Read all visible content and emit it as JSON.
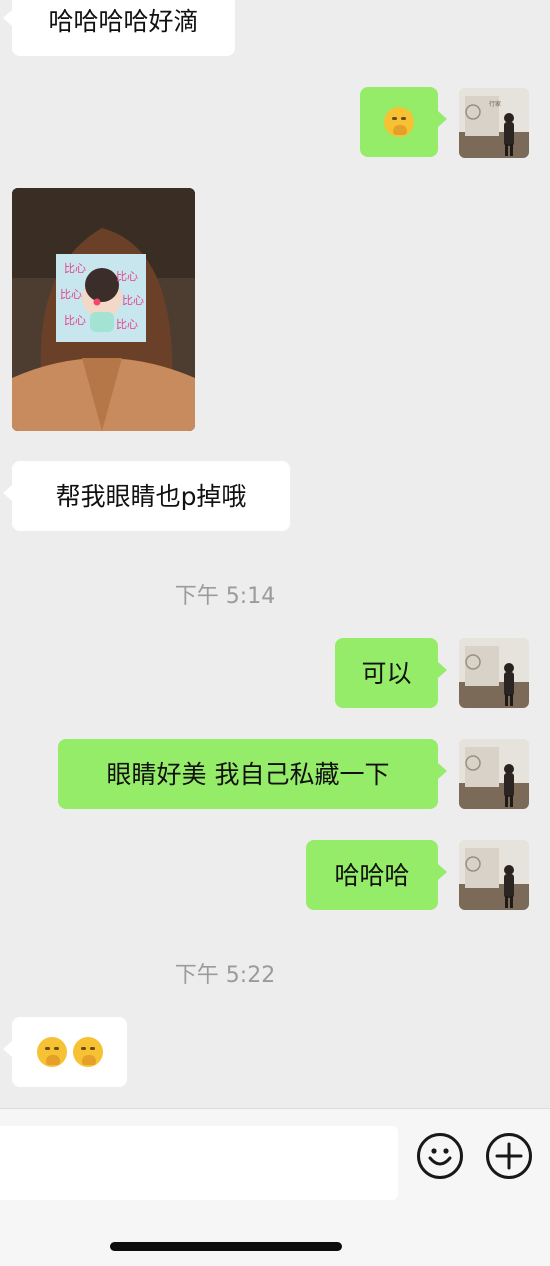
{
  "messages": {
    "m1_text": "哈哈哈哈好滴",
    "m5_text": "帮我眼睛也p掉哦",
    "m6_text": "可以",
    "m7_text": "眼睛好美 我自己私藏一下",
    "m8_text": "哈哈哈"
  },
  "photo": {
    "sticker_text": "比心"
  },
  "timestamps": {
    "t1": "下午 5:14",
    "t2": "下午 5:22"
  },
  "avatar": {
    "sign_text": "行家"
  },
  "colors": {
    "incoming_bubble": "#ffffff",
    "outgoing_bubble": "#95ec69",
    "background": "#ededed"
  },
  "input_bar": {
    "input_value": "",
    "icons": [
      "emoji-icon",
      "plus-icon"
    ]
  }
}
